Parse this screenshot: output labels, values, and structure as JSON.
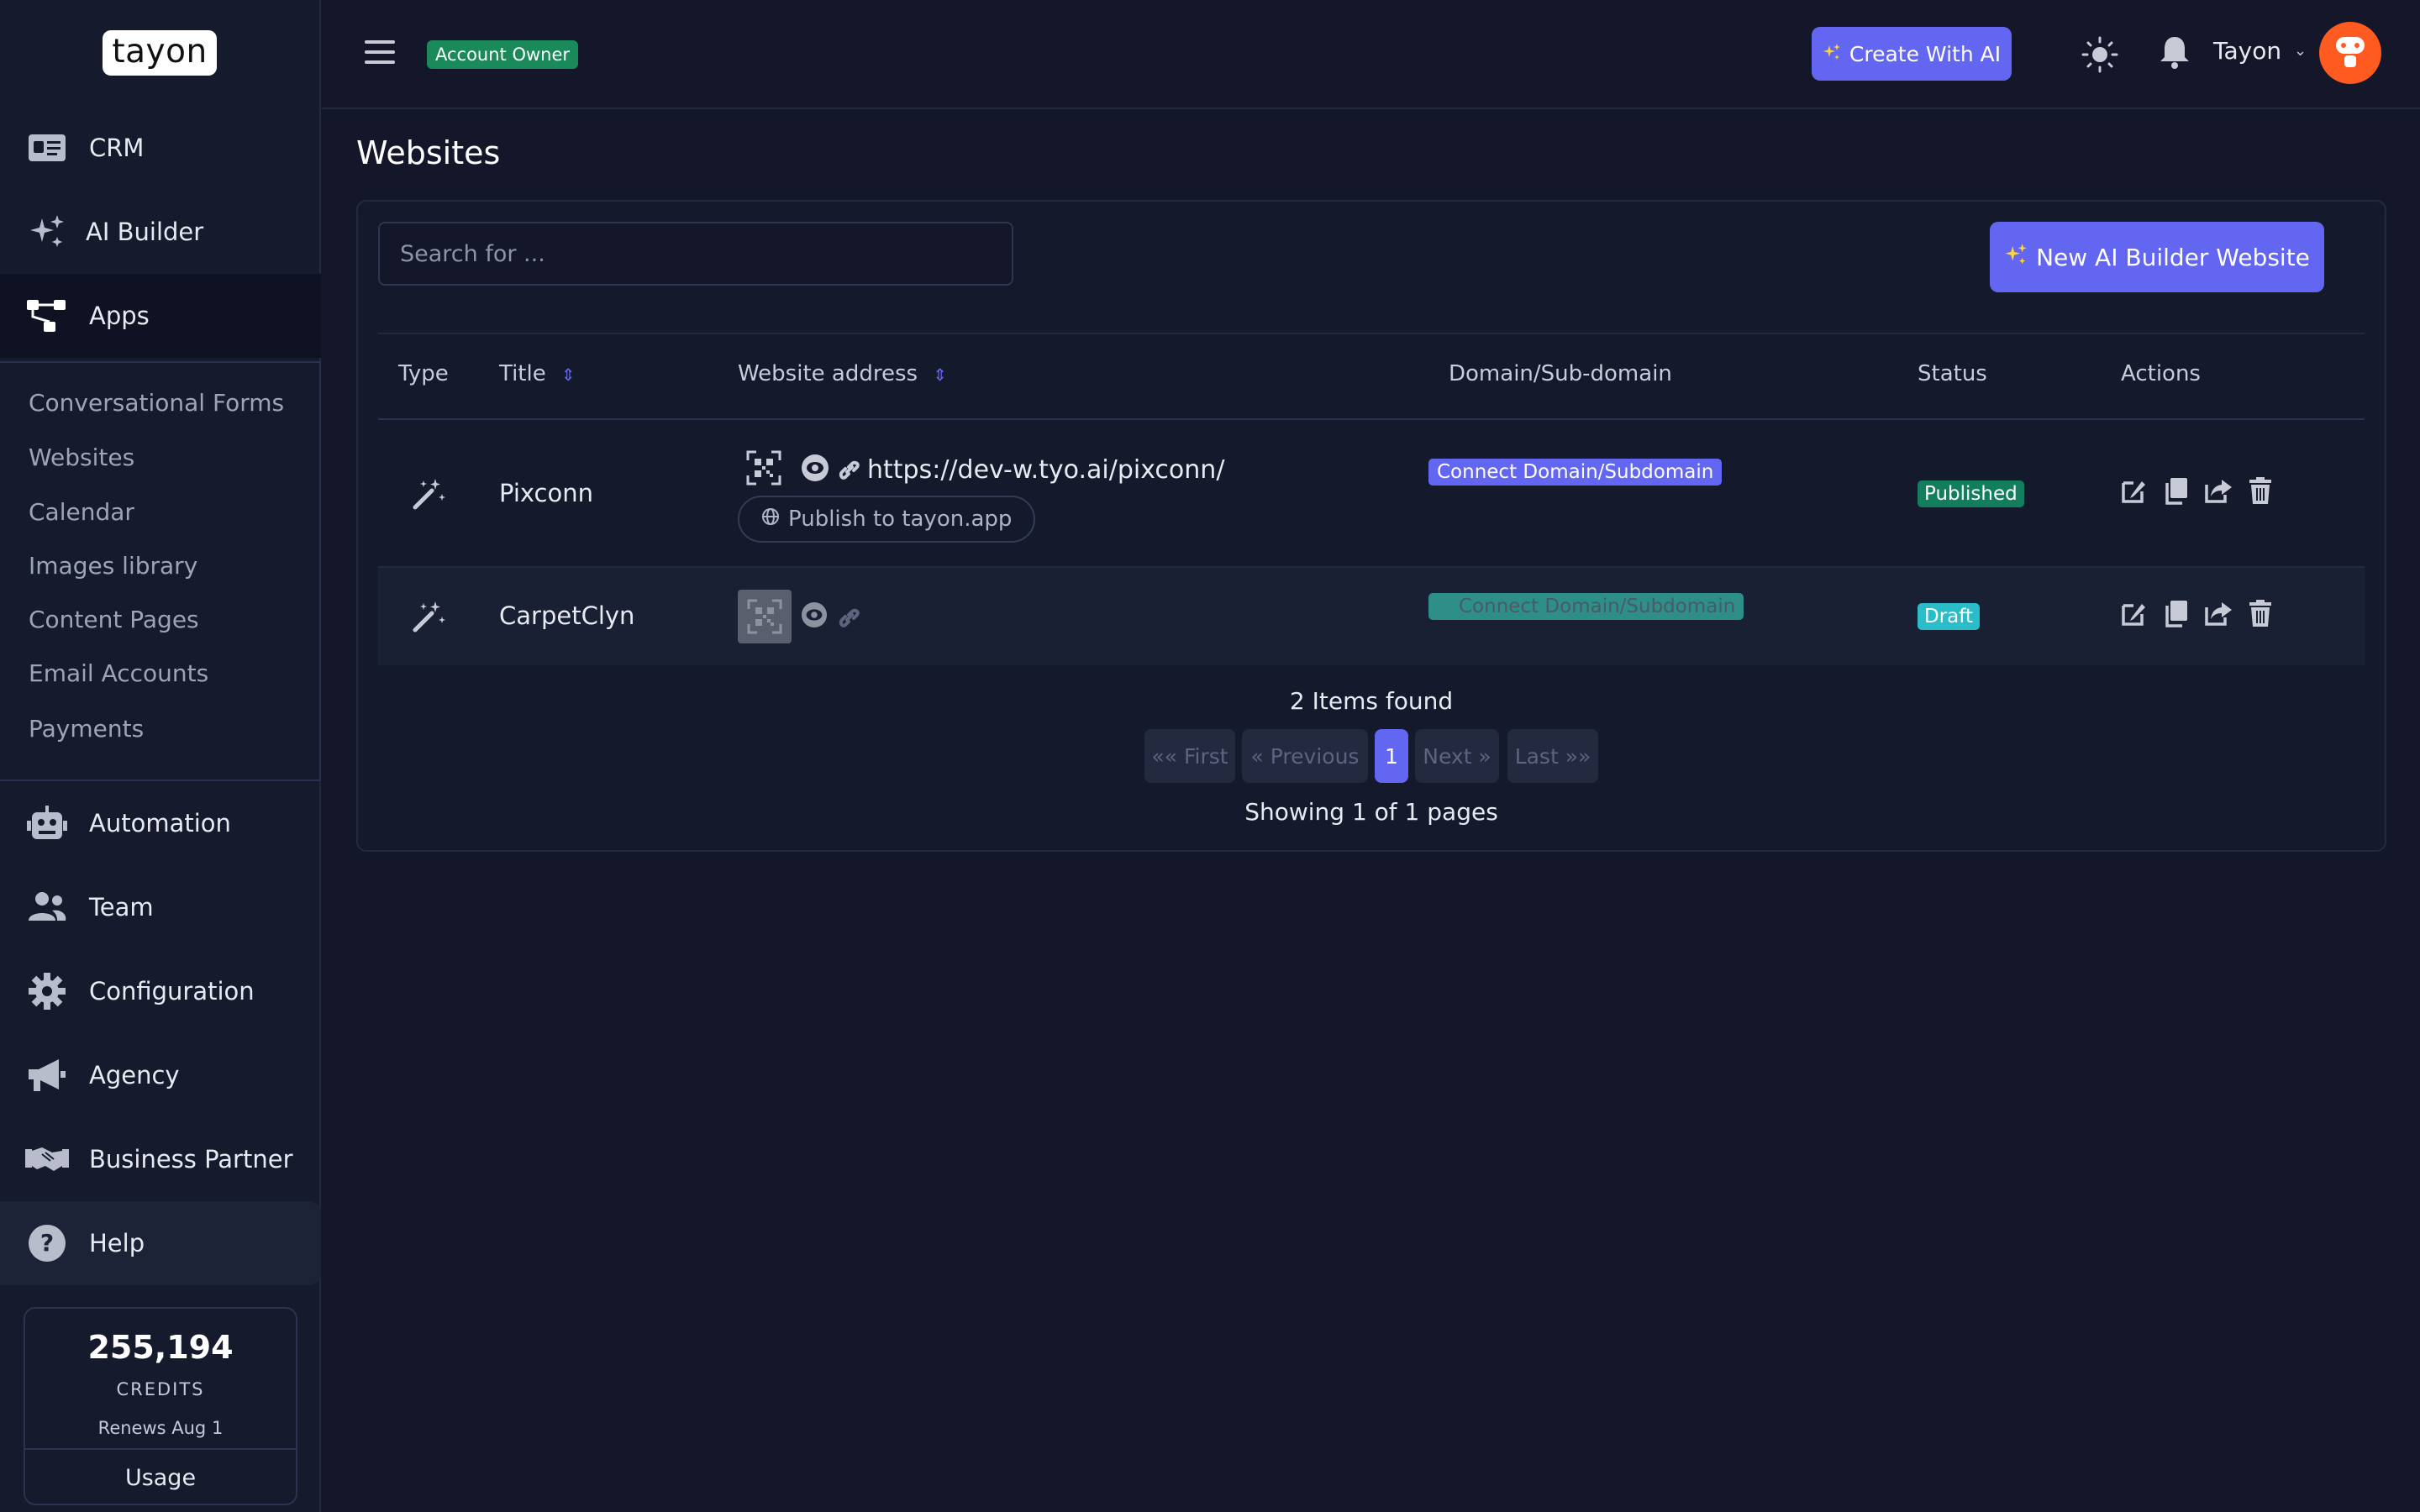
{
  "brand": {
    "logo_text": "tayon"
  },
  "sidebar": {
    "items": [
      {
        "label": "CRM",
        "icon": "id-card-icon"
      },
      {
        "label": "AI Builder",
        "icon": "sparkles-icon"
      },
      {
        "label": "Apps",
        "icon": "sitemap-icon"
      },
      {
        "label": "Automation",
        "icon": "robot-icon"
      },
      {
        "label": "Team",
        "icon": "users-icon"
      },
      {
        "label": "Configuration",
        "icon": "gear-icon"
      },
      {
        "label": "Agency",
        "icon": "megaphone-icon"
      },
      {
        "label": "Business Partner",
        "icon": "handshake-icon"
      },
      {
        "label": "Help",
        "icon": "question-circle-icon"
      }
    ],
    "submenu": [
      "Conversational Forms",
      "Websites",
      "Calendar",
      "Images library",
      "Content Pages",
      "Email Accounts",
      "Payments"
    ],
    "credits": {
      "value": "255,194",
      "label": "CREDITS",
      "renews": "Renews Aug 1",
      "usage_label": "Usage"
    }
  },
  "header": {
    "role_badge": "Account Owner",
    "create_button": "Create With AI",
    "user_name": "Tayon"
  },
  "page": {
    "title": "Websites",
    "search_placeholder": "Search for ...",
    "new_button": "New AI Builder Website"
  },
  "table": {
    "columns": [
      "Type",
      "Title",
      "Website address",
      "Domain/Sub-domain",
      "Status",
      "Actions"
    ],
    "rows": [
      {
        "title": "Pixconn",
        "url": "https://dev-w.tyo.ai/pixconn/",
        "publish_label": "Publish to tayon.app",
        "domain_action": "Connect Domain/Subdomain",
        "status": "Published"
      },
      {
        "title": "CarpetClyn",
        "url": "",
        "domain_action": "Connect Domain/Subdomain",
        "status": "Draft"
      }
    ]
  },
  "pagination": {
    "items_found": "2 Items found",
    "first": "«« First",
    "previous": "« Previous",
    "current": "1",
    "next": "Next »",
    "last": "Last »»",
    "showing": "Showing 1 of 1 pages"
  },
  "colors": {
    "accent": "#6366f1",
    "published": "#127e5e",
    "draft": "#2bbcc9",
    "account_badge": "#1a8a5a",
    "avatar": "#ff5a1f"
  }
}
